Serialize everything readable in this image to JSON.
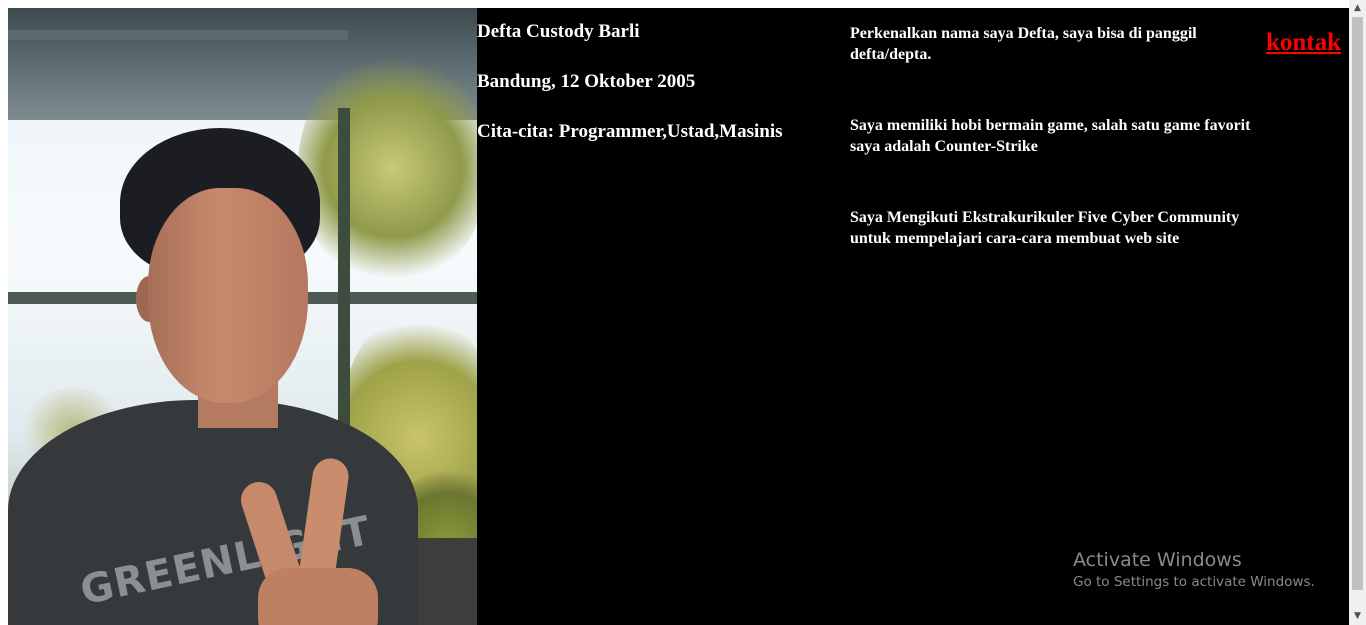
{
  "profile": {
    "name": "Defta Custody Barli",
    "birth": "Bandung, 12 Oktober 2005",
    "goals": "Cita-cita: Programmer,Ustad,Masinis"
  },
  "about": {
    "intro": "Perkenalkan nama saya Defta, saya bisa di panggil defta/depta.",
    "hobby": "Saya memiliki hobi bermain game, salah satu game favorit saya adalah Counter-Strike",
    "club": "Saya Mengikuti Ekstrakurikuler Five Cyber Community untuk mempelajari cara-cara membuat web site"
  },
  "nav": {
    "contact_link": "kontak"
  },
  "photo": {
    "shirt_text": "GREENLIGHT"
  },
  "os_watermark": {
    "title": "Activate Windows",
    "subtitle": "Go to Settings to activate Windows."
  },
  "colors": {
    "background": "#000000",
    "text": "#ffffff",
    "link": "#ff0000"
  },
  "icons": {
    "scroll_up": "scroll-up-arrow-icon",
    "scroll_down": "scroll-down-arrow-icon"
  }
}
